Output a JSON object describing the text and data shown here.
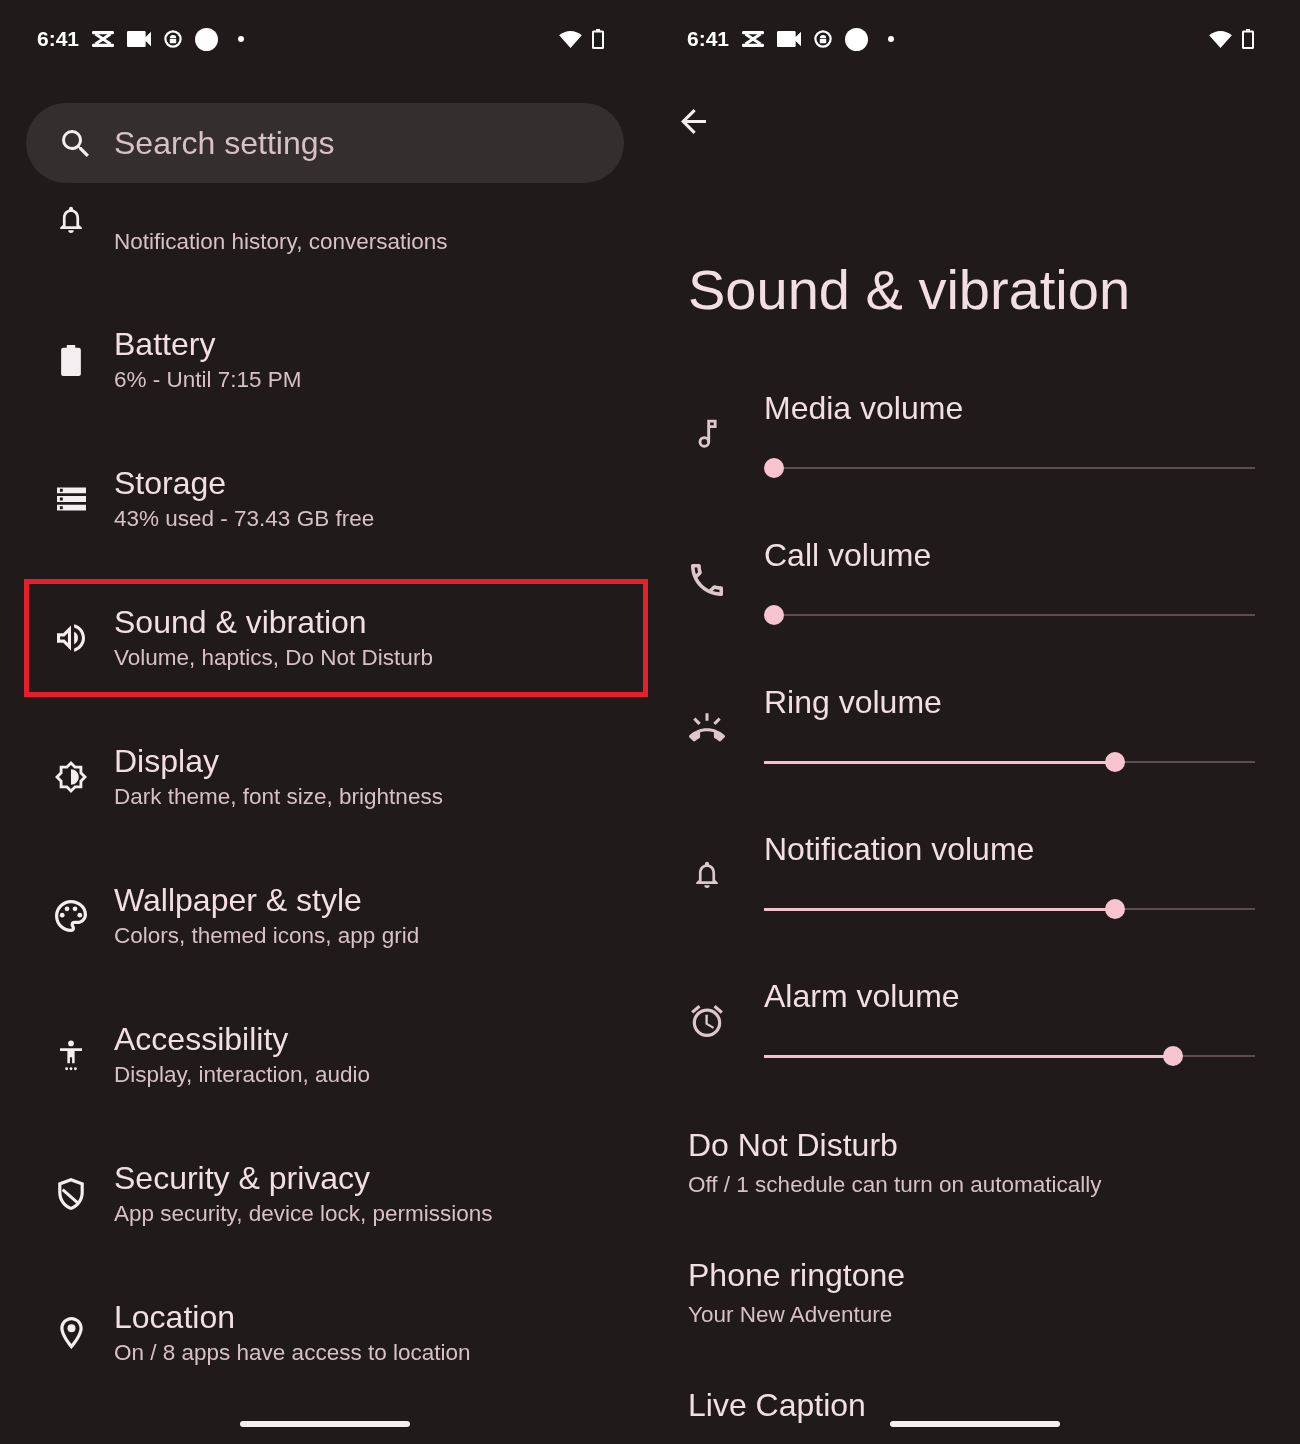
{
  "left_screen": {
    "status_bar": {
      "time": "6:41"
    },
    "search": {
      "placeholder": "Search settings"
    },
    "items": [
      {
        "subtitle": "Notification history, conversations",
        "highlighted": false
      },
      {
        "title": "Battery",
        "subtitle": "6% - Until 7:15 PM",
        "highlighted": false
      },
      {
        "title": "Storage",
        "subtitle": "43% used - 73.43 GB free",
        "highlighted": false
      },
      {
        "title": "Sound & vibration",
        "subtitle": "Volume, haptics, Do Not Disturb",
        "highlighted": true
      },
      {
        "title": "Display",
        "subtitle": "Dark theme, font size, brightness",
        "highlighted": false
      },
      {
        "title": "Wallpaper & style",
        "subtitle": "Colors, themed icons, app grid",
        "highlighted": false
      },
      {
        "title": "Accessibility",
        "subtitle": "Display, interaction, audio",
        "highlighted": false
      },
      {
        "title": "Security & privacy",
        "subtitle": "App security, device lock, permissions",
        "highlighted": false
      },
      {
        "title": "Location",
        "subtitle": "On / 8 apps have access to location",
        "highlighted": false
      }
    ]
  },
  "right_screen": {
    "status_bar": {
      "time": "6:41"
    },
    "title": "Sound & vibration",
    "volumes": [
      {
        "label": "Media volume",
        "level": 0
      },
      {
        "label": "Call volume",
        "level": 0
      },
      {
        "label": "Ring volume",
        "level": 0.715
      },
      {
        "label": "Notification volume",
        "level": 0.715
      },
      {
        "label": "Alarm volume",
        "level": 0.833
      }
    ],
    "items": [
      {
        "title": "Do Not Disturb",
        "subtitle": "Off / 1 schedule can turn on automatically"
      },
      {
        "title": "Phone ringtone",
        "subtitle": "Your New Adventure"
      },
      {
        "title": "Live Caption"
      }
    ]
  }
}
